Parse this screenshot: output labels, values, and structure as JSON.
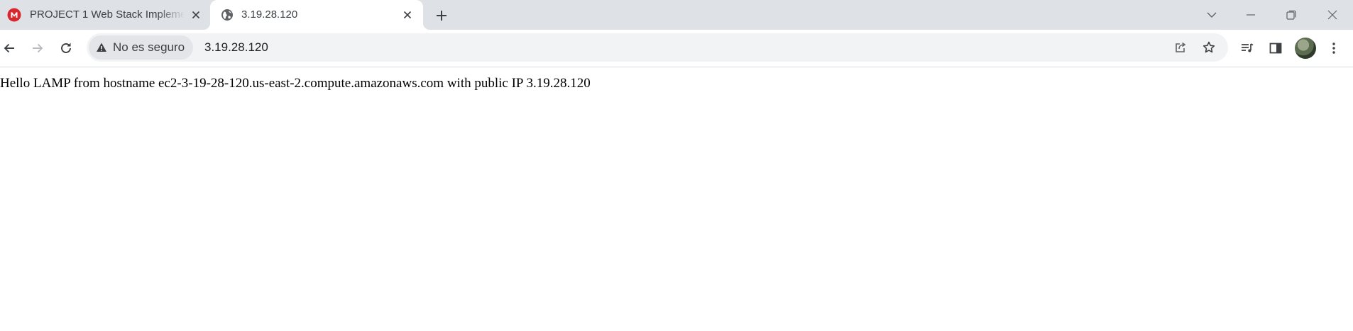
{
  "tabs": [
    {
      "title": "PROJECT 1 Web Stack Implemen",
      "favicon": "mega-logo-icon",
      "active": false
    },
    {
      "title": "3.19.28.120",
      "favicon": "globe-icon",
      "active": true
    }
  ],
  "address_bar": {
    "security_label": "No es seguro",
    "url": "3.19.28.120"
  },
  "page": {
    "text": "Hello LAMP from hostname ec2-3-19-28-120.us-east-2.compute.amazonaws.com with public IP 3.19.28.120"
  },
  "colors": {
    "tabstrip": "#dee1e6",
    "omnibox": "#f1f3f4",
    "mega_red": "#d9272e",
    "icon": "#5f6368"
  }
}
